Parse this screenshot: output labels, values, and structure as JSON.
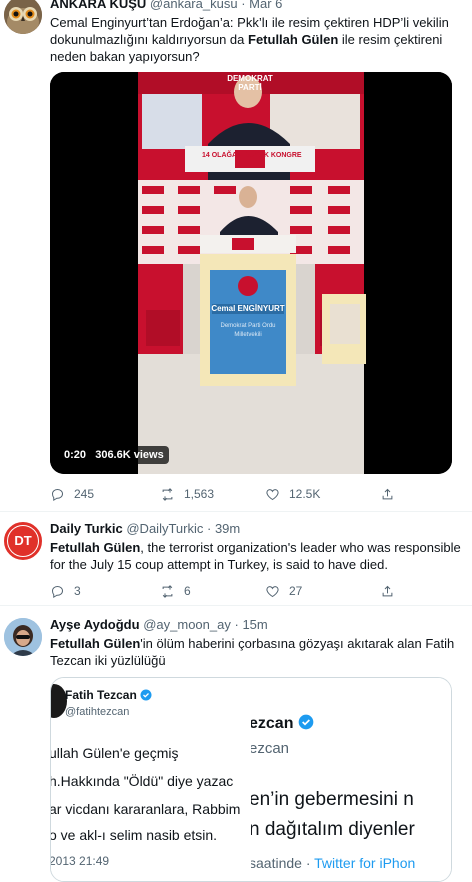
{
  "tweets": [
    {
      "name": "ANKARA KUŞU",
      "handle": "@ankara_kusu",
      "sep": "·",
      "time": "Mar 6",
      "text_pre": "Cemal Enginyurt’tan Erdoğan’a: Pkk’lı ile resim çektiren HDP’li vekilin dokunulmazlığını kaldırıyorsun da ",
      "text_bold": "Fetullah Gülen",
      "text_post": " ile resim çektireni neden bakan yapıyorsun?",
      "video": {
        "duration": "0:20",
        "views": "306.6K views",
        "banner_text": "14 OLAĞAN BÜYÜK KONGRE",
        "party_text": "DEMOKRAT PARTİ",
        "podium_name": "Cemal ENGİNYURT",
        "podium_sub1": "Demokrat Parti Ordu",
        "podium_sub2": "Milletvekili"
      },
      "counts": {
        "replies": "245",
        "retweets": "1,563",
        "likes": "12.5K"
      }
    },
    {
      "name": "Daily Turkic",
      "handle": "@DailyTurkic",
      "sep": "·",
      "time": "39m",
      "avatar_text": "DT",
      "text_bold": "Fetullah Gülen",
      "text_post": ", the terrorist organization's leader who was responsible for the July 15 coup attempt in Turkey, is said to have died.",
      "counts": {
        "replies": "3",
        "retweets": "6",
        "likes": "27"
      }
    },
    {
      "name": "Ayşe Aydoğdu",
      "handle": "@ay_moon_ay",
      "sep": "·",
      "time": "15m",
      "text_bold": "Fetullah Gülen",
      "text_post": "'in ölüm haberini çorbasına gözyaşı akıtarak alan Fatih Tezcan iki yüzlülüğü",
      "quote": {
        "left": {
          "name": "Fatih Tezcan",
          "handle": "@fatihtezcan",
          "line1": "ullah Gülen'e geçmiş",
          "line2": "h.Hakkında \"Öldü\" diye yazac",
          "line3": "ar vicdanı kararanlara, Rabbim",
          "line4": "o ve akl-ı selim nasib etsin.",
          "time": "2013 21:49"
        },
        "right": {
          "name": "ezcan",
          "handle": "ezcan",
          "line1": "en’in gebermesini n",
          "line2": "n dağıtalım diyenler",
          "footer_time": "saatinde · ",
          "footer_source": "Twitter for iPhon"
        }
      }
    }
  ],
  "colors": {
    "accent": "#1d9bf0",
    "muted": "#536471",
    "dt_red": "#e0312a",
    "podium_blue": "#3f89c8",
    "stage_red": "#c8102e"
  },
  "icons": [
    "reply-icon",
    "retweet-icon",
    "like-icon",
    "share-icon",
    "verified-icon"
  ]
}
